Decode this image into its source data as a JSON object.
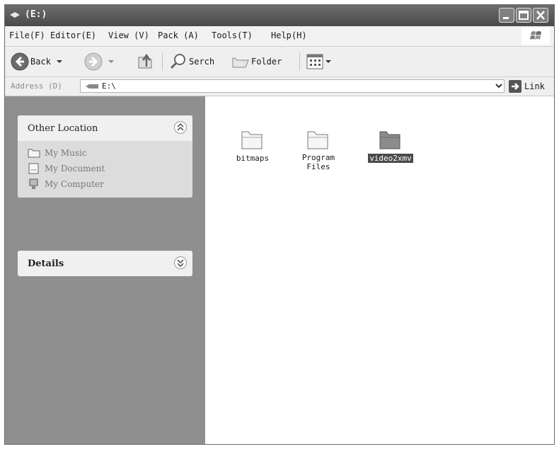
{
  "window": {
    "title": "(E:)"
  },
  "menubar": {
    "items": [
      "File(F)",
      "Editor(E)",
      "View (V)",
      "Pack (A)",
      "Tools(T)",
      "Help(H)"
    ]
  },
  "toolbar": {
    "back_label": "Back",
    "search_label": "Serch",
    "folders_label": "Folder"
  },
  "address": {
    "label": "Address (D)",
    "value": "E:\\",
    "links_label": "Link"
  },
  "sidebar": {
    "other_places": {
      "title": "Other Location",
      "items": [
        "My Music",
        "My Document",
        "My Computer"
      ]
    },
    "details": {
      "title": "Details"
    }
  },
  "files": [
    {
      "label": "bitmaps",
      "selected": false
    },
    {
      "label": "Program\nFiles",
      "selected": false
    },
    {
      "label": "video2xmv",
      "selected": true
    }
  ]
}
